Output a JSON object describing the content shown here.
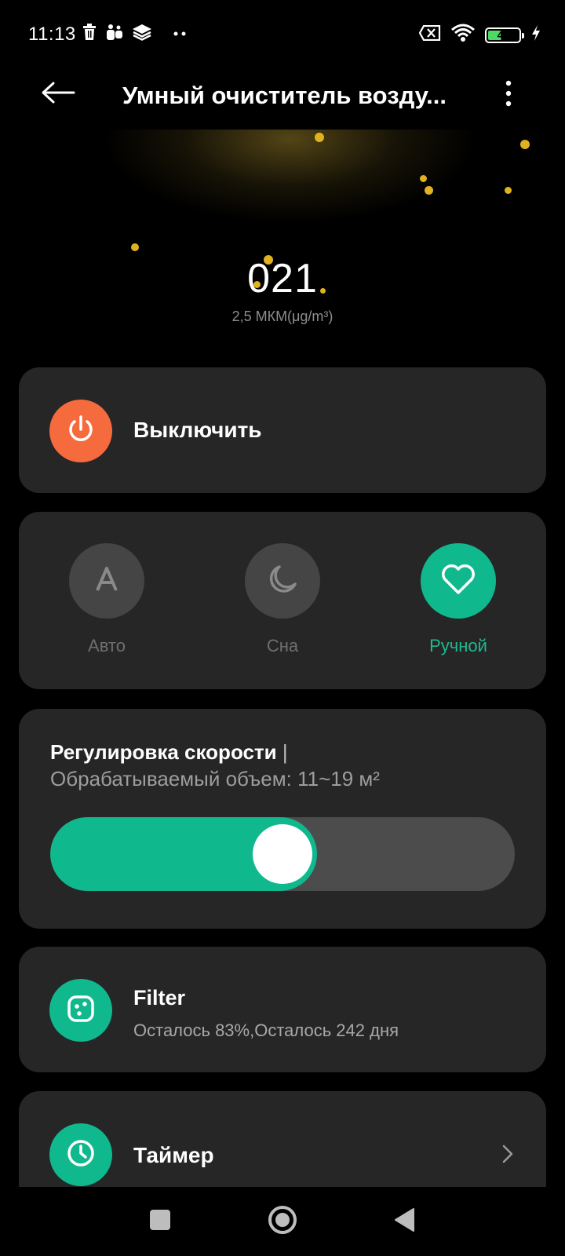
{
  "status_bar": {
    "time": "11:13",
    "battery_level": "44",
    "battery_percent": 44,
    "left_icons": [
      "trash-icon",
      "teams-icon",
      "layers-icon",
      "dots-icon"
    ],
    "right_icons": [
      "no-sim-icon",
      "wifi-icon",
      "battery-icon",
      "charging-icon"
    ]
  },
  "header": {
    "title": "Умный очиститель возду...",
    "back_icon": "arrow-left-icon",
    "more_icon": "more-vertical-icon"
  },
  "air_quality": {
    "value": "021",
    "unit": "2,5 МКМ(μg/m³)"
  },
  "power": {
    "label": "Выключить",
    "icon": "power-icon",
    "color": "#f56b3d"
  },
  "modes": {
    "items": [
      {
        "label": "Авто",
        "icon": "auto-a-icon",
        "active": false
      },
      {
        "label": "Сна",
        "icon": "moon-icon",
        "active": false
      },
      {
        "label": "Ручной",
        "icon": "heart-icon",
        "active": true
      }
    ],
    "active_color": "#10b88d"
  },
  "speed": {
    "title": "Регулировка скорости",
    "separator": "|",
    "subtitle": "Обрабатываемый объем: 11~19 м²",
    "level": 0.5
  },
  "filter": {
    "title": "Filter",
    "subtitle": "Осталось 83%,Осталось 242 дня",
    "icon": "filter-icon"
  },
  "timer": {
    "label": "Таймер",
    "icon": "clock-icon",
    "chevron_icon": "chevron-right-icon"
  },
  "nav_bar": {
    "icons": [
      "recents-square-icon",
      "home-circle-icon",
      "back-triangle-icon"
    ]
  },
  "colors": {
    "accent": "#10b88d",
    "power": "#f56b3d",
    "card": "#262626",
    "particle": "#e0b31e"
  }
}
